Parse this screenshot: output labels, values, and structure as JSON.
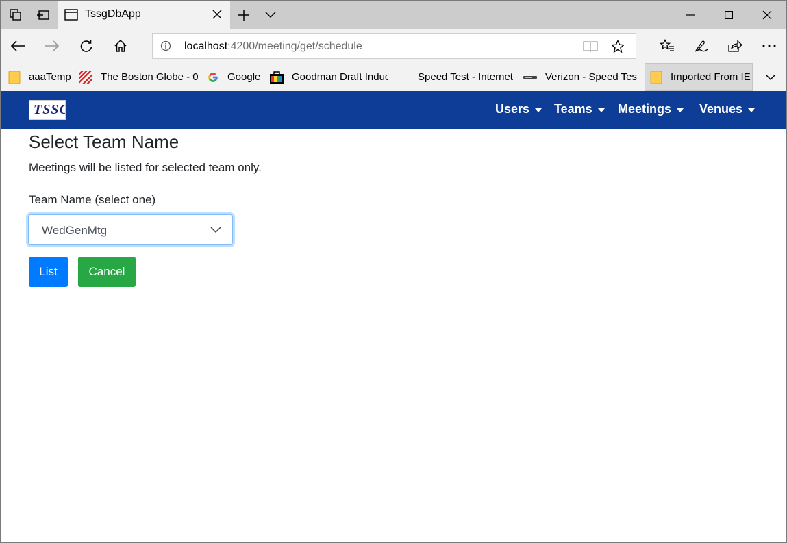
{
  "browser": {
    "tab_title": "TssgDbApp",
    "url_host": "localhost",
    "url_rest": ":4200/meeting/get/schedule",
    "favorites": [
      {
        "label": "aaaTemp",
        "icon": "folder-icon"
      },
      {
        "label": "The Boston Globe - 0",
        "icon": "boston-globe-icon"
      },
      {
        "label": "Google",
        "icon": "google-icon"
      },
      {
        "label": "Goodman Draft Induc",
        "icon": "goodman-icon"
      },
      {
        "label": "Speed Test - Internet",
        "icon": "blank-icon"
      },
      {
        "label": "Verizon - Speed Test",
        "icon": "verizon-icon"
      },
      {
        "label": "Imported From IE",
        "icon": "folder-icon"
      }
    ]
  },
  "app": {
    "logo_text": "TSSG",
    "menu": [
      {
        "label": "Users"
      },
      {
        "label": "Teams"
      },
      {
        "label": "Meetings"
      },
      {
        "label": "Venues"
      }
    ]
  },
  "page": {
    "heading": "Select Team Name",
    "subtext": "Meetings will be listed for selected team only.",
    "select_label": "Team Name (select one)",
    "select_value": "WedGenMtg",
    "list_button": "List",
    "cancel_button": "Cancel"
  },
  "colors": {
    "navbar": "#0e3d98",
    "primary": "#007bff",
    "success": "#28a745"
  }
}
